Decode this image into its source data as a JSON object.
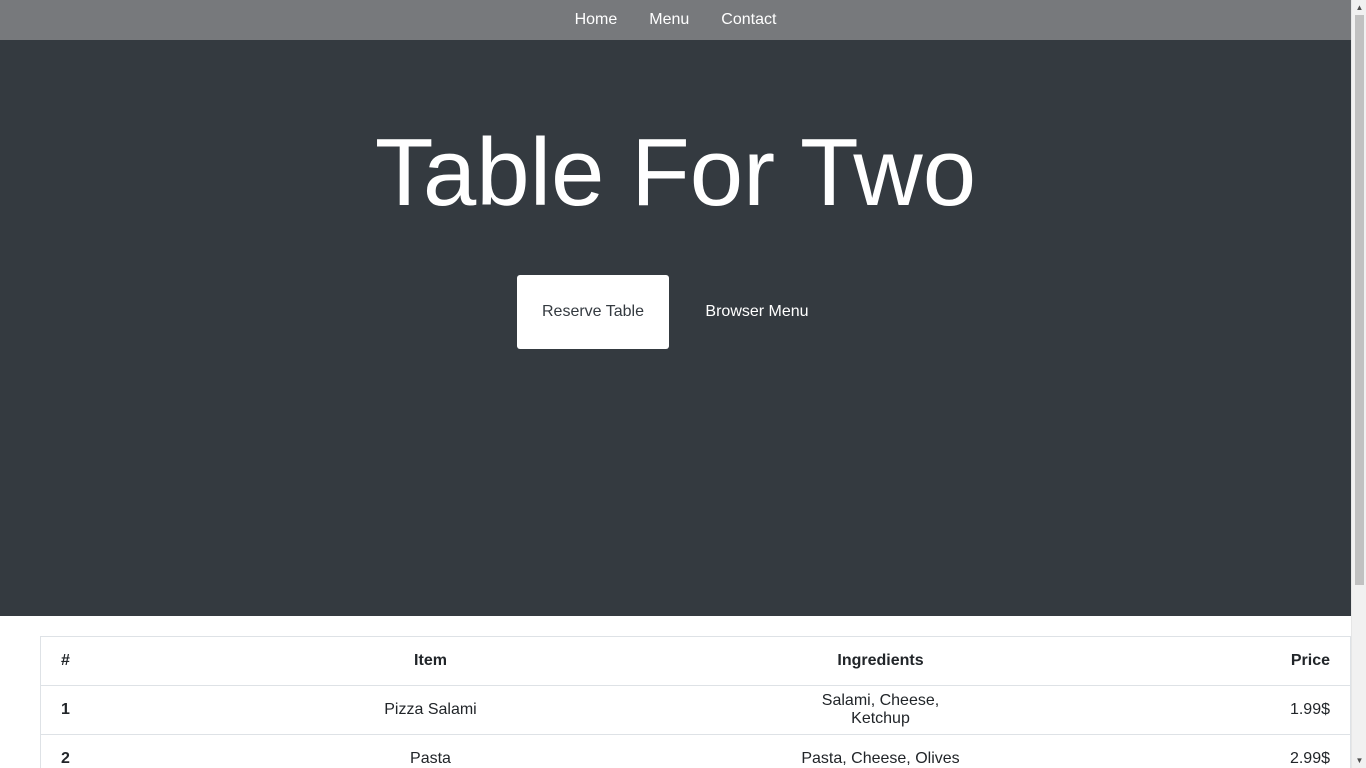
{
  "nav": {
    "items": [
      {
        "label": "Home"
      },
      {
        "label": "Menu"
      },
      {
        "label": "Contact"
      }
    ]
  },
  "hero": {
    "title": "Table For Two",
    "reserve_label": "Reserve Table",
    "browse_label": "Browser Menu"
  },
  "table": {
    "headers": {
      "num": "#",
      "item": "Item",
      "ingredients": "Ingredients",
      "price": "Price"
    },
    "rows": [
      {
        "num": "1",
        "item": "Pizza Salami",
        "ingredients": "Salami, Cheese, Ketchup",
        "price": "1.99$"
      },
      {
        "num": "2",
        "item": "Pasta",
        "ingredients": "Pasta, Cheese, Olives",
        "price": "2.99$"
      }
    ]
  },
  "colors": {
    "navbar_bg": "#77797c",
    "hero_bg": "#343a40",
    "text_light": "#ffffff",
    "text_dark": "#212529"
  },
  "icons": {
    "scroll_up": "scroll-up-arrow-icon",
    "scroll_down": "scroll-down-arrow-icon"
  }
}
